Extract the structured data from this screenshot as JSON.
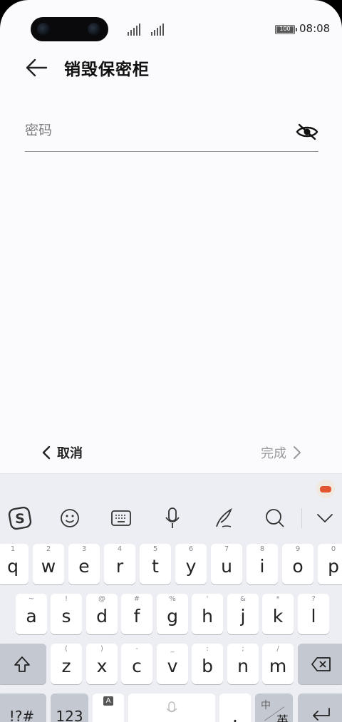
{
  "status": {
    "battery": "100",
    "time": "08:08"
  },
  "header": {
    "title": "销毁保密柜"
  },
  "form": {
    "password_placeholder": "密码",
    "password_value": ""
  },
  "actions": {
    "cancel_label": "取消",
    "done_label": "完成"
  },
  "keyboard": {
    "row1": [
      {
        "key": "q",
        "hint": "1"
      },
      {
        "key": "w",
        "hint": "2"
      },
      {
        "key": "e",
        "hint": "3"
      },
      {
        "key": "r",
        "hint": "4"
      },
      {
        "key": "t",
        "hint": "5"
      },
      {
        "key": "y",
        "hint": "6"
      },
      {
        "key": "u",
        "hint": "7"
      },
      {
        "key": "i",
        "hint": "8"
      },
      {
        "key": "o",
        "hint": "9"
      },
      {
        "key": "p",
        "hint": "0"
      }
    ],
    "row2": [
      {
        "key": "a",
        "hint": "~"
      },
      {
        "key": "s",
        "hint": "!"
      },
      {
        "key": "d",
        "hint": "@"
      },
      {
        "key": "f",
        "hint": "#"
      },
      {
        "key": "g",
        "hint": "%"
      },
      {
        "key": "h",
        "hint": "'"
      },
      {
        "key": "j",
        "hint": "&"
      },
      {
        "key": "k",
        "hint": "*"
      },
      {
        "key": "l",
        "hint": "?"
      }
    ],
    "row3": [
      {
        "key": "z",
        "hint": "("
      },
      {
        "key": "x",
        "hint": ")"
      },
      {
        "key": "c",
        "hint": "-"
      },
      {
        "key": "v",
        "hint": "_"
      },
      {
        "key": "b",
        "hint": ":"
      },
      {
        "key": "n",
        "hint": ";"
      },
      {
        "key": "m",
        "hint": "/"
      }
    ],
    "symbols_label": "!?#",
    "numbers_label": "123",
    "comma_label": ",",
    "comma_hint": "A",
    "period_label": ".",
    "lang_label_top": "中",
    "lang_label_bottom": "英"
  }
}
